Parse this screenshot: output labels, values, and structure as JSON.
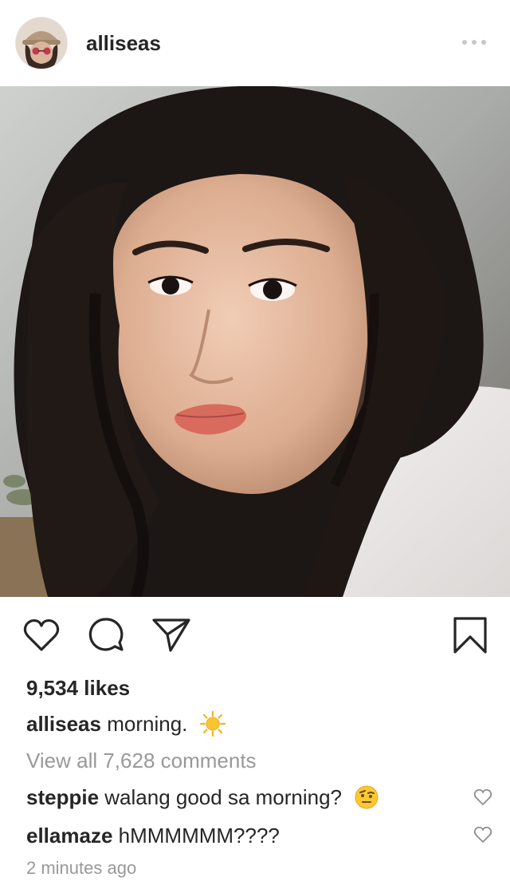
{
  "post": {
    "username": "alliseas",
    "likes": "9,534 likes",
    "caption_user": "alliseas",
    "caption_text": "morning.",
    "view_all": "View all 7,628 comments",
    "time_ago": "2 minutes ago"
  },
  "comments": [
    {
      "user": "steppie",
      "text": "walang good sa morning?"
    },
    {
      "user": "ellamaze",
      "text": "hMMMMMM????"
    }
  ],
  "icons": {
    "like": "heart-icon",
    "comment": "comment-bubble-icon",
    "share": "paper-plane-icon",
    "save": "bookmark-icon",
    "more": "ellipsis-icon",
    "caption_emoji": "sun-emoji",
    "comment_emoji": "raised-eyebrow-emoji"
  },
  "colors": {
    "text": "#262626",
    "muted": "#999999",
    "divider": "#c7c7c7"
  }
}
